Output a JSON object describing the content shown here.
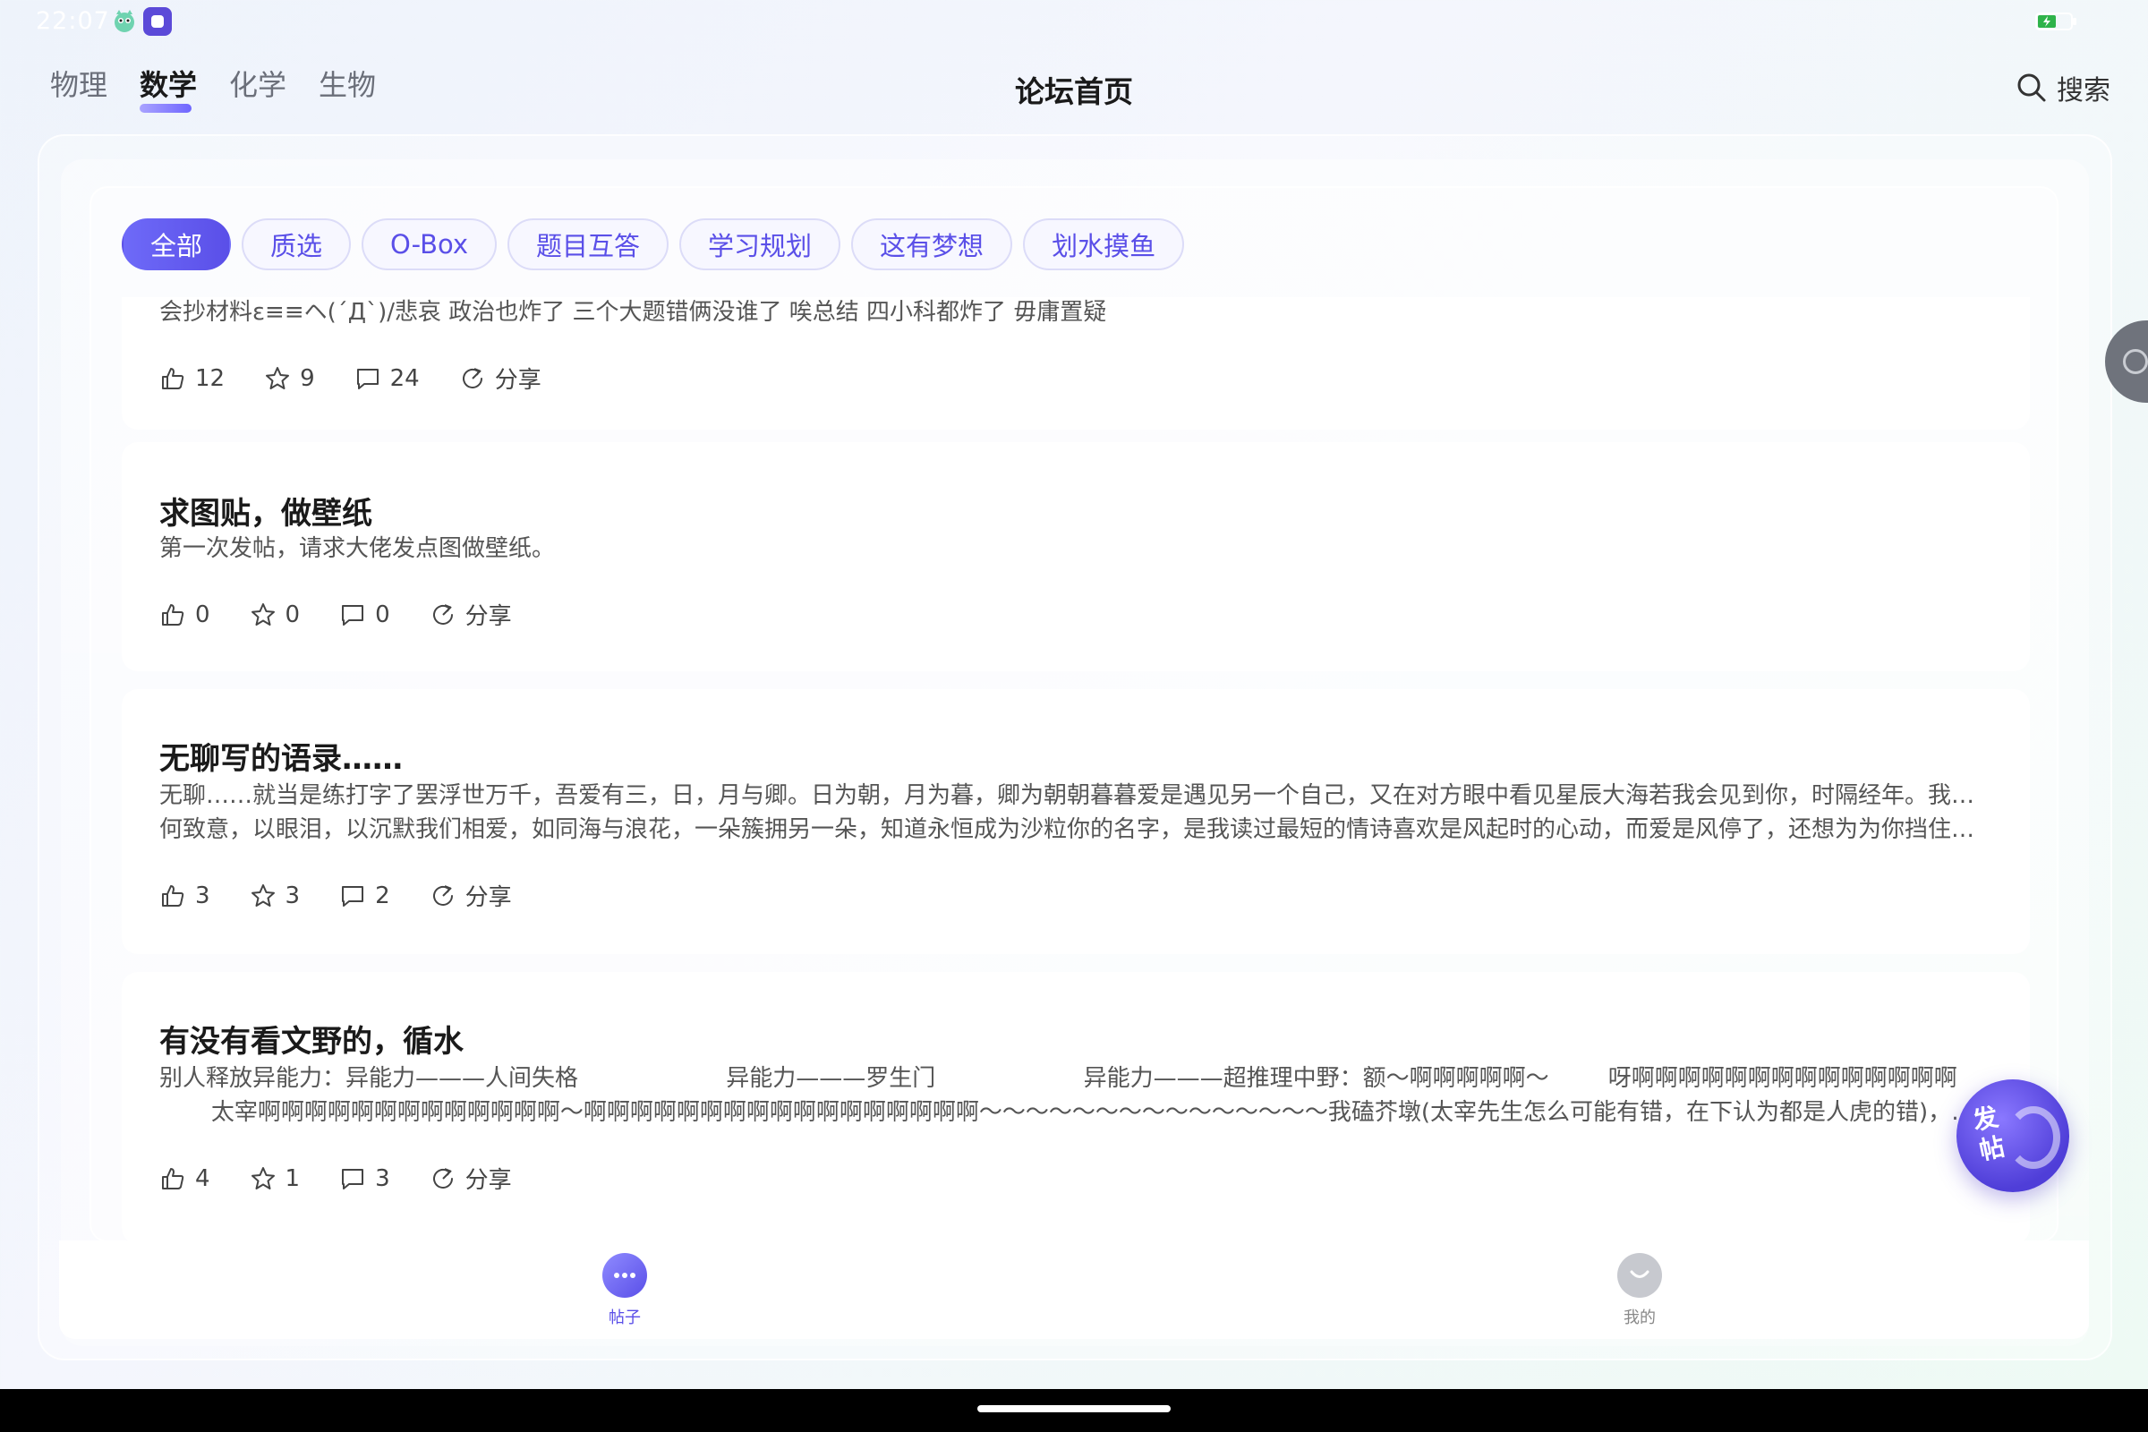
{
  "status_bar": {
    "time": "22:07"
  },
  "header": {
    "subject_tabs": [
      "物理",
      "数学",
      "化学",
      "生物"
    ],
    "active_subject": "数学",
    "title": "论坛首页",
    "search_label": "搜索"
  },
  "categories": [
    "全部",
    "质选",
    "O-Box",
    "题目互答",
    "学习规划",
    "这有梦想",
    "划水摸鱼"
  ],
  "active_category": "全部",
  "posts": [
    {
      "title": "",
      "body_lines": [
        "会抄材料ε≡≡ヘ(´Д`)/悲哀 政治也炸了 三个大题错俩没谁了 唉总结 四小科都炸了 毋庸置疑"
      ],
      "likes": "12",
      "stars": "9",
      "comments": "24",
      "share": "分享"
    },
    {
      "title": "求图贴，做壁纸",
      "body_lines": [
        "第一次发帖，请求大佬发点图做壁纸。"
      ],
      "likes": "0",
      "stars": "0",
      "comments": "0",
      "share": "分享"
    },
    {
      "title": "无聊写的语录……",
      "body_lines": [
        "无聊……就当是练打字了罢浮世万千，吾爱有三，日，月与卿。日为朝，月为暮，卿为朝朝暮暮爱是遇见另一个自己，又在对方眼中看见星辰大海若我会见到你，时隔经年。我该如",
        "何致意，以眼泪，以沉默我们相爱，如同海与浪花，一朵簇拥另一朵，知道永恒成为沙粒你的名字，是我读过最短的情诗喜欢是风起时的心动，而爱是风停了，还想为为你挡住…"
      ],
      "likes": "3",
      "stars": "3",
      "comments": "2",
      "share": "分享"
    },
    {
      "title": "有没有看文野的，循水",
      "body_lines": [
        "别人释放异能力：异能力———人间失格                    异能力———罗生门                    异能力———超推理中野：额～啊啊啊啊啊～        呀啊啊啊啊啊啊啊啊啊啊啊啊啊啊",
        "       太宰啊啊啊啊啊啊啊啊啊啊啊啊啊～啊啊啊啊啊啊啊啊啊啊啊啊啊啊啊啊啊～～～～～～～～～～～～～～～我磕芥墩(太宰先生怎么可能有错，在下认为都是人虎的错)，你们呢"
      ],
      "likes": "4",
      "stars": "1",
      "comments": "3",
      "share": "分享"
    }
  ],
  "bottom_nav": {
    "posts_label": "帖子",
    "mine_label": "我的"
  },
  "fab": {
    "label": "发帖"
  },
  "colors": {
    "accent": "#5a4fe8",
    "chip_border": "#dcdcf8"
  },
  "icons": [
    "search-icon",
    "thumb-up-icon",
    "star-icon",
    "comment-icon",
    "share-icon",
    "chat-bubble-icon",
    "profile-icon",
    "battery-icon"
  ]
}
